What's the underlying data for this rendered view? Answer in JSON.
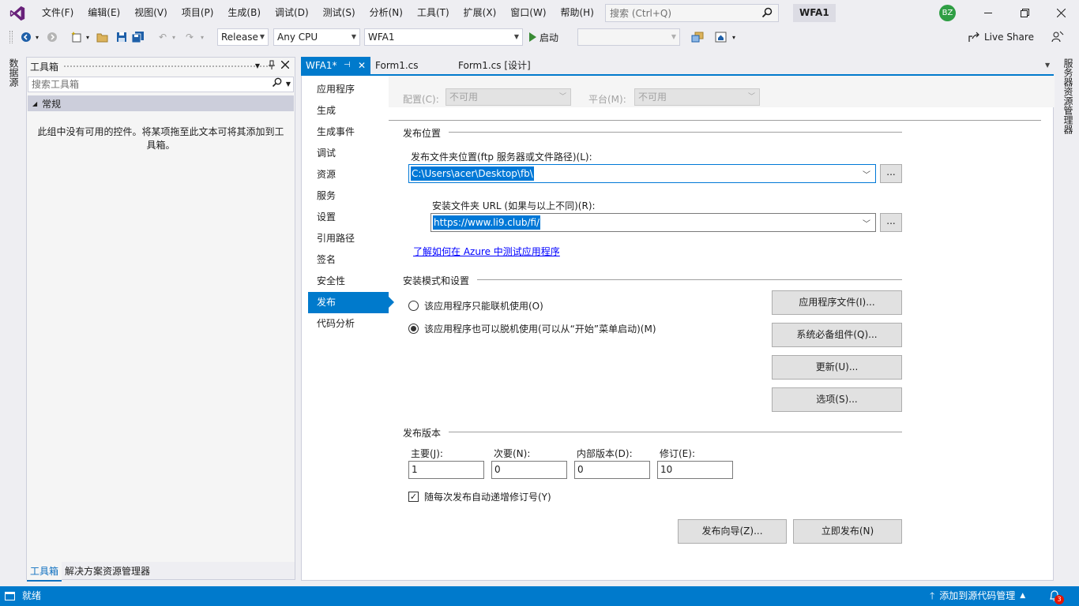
{
  "menu": {
    "items": [
      "文件(F)",
      "编辑(E)",
      "视图(V)",
      "项目(P)",
      "生成(B)",
      "调试(D)",
      "测试(S)",
      "分析(N)",
      "工具(T)",
      "扩展(X)",
      "窗口(W)",
      "帮助(H)"
    ],
    "search_placeholder": "搜索 (Ctrl+Q)",
    "solution_name": "WFA1",
    "user_initials": "BZ"
  },
  "toolbar": {
    "configuration": "Release",
    "platform": "Any CPU",
    "startup_project": "WFA1",
    "start_label": "启动",
    "live_share_label": "Live Share"
  },
  "left_vertical_tab": "数据源",
  "right_vertical_tab": "服务器资源管理器",
  "toolbox": {
    "title": "工具箱",
    "search_placeholder": "搜索工具箱",
    "group_name": "常规",
    "empty_message": "此组中没有可用的控件。将某项拖至此文本可将其添加到工具箱。",
    "bottom_tabs": [
      "工具箱",
      "解决方案资源管理器"
    ]
  },
  "doc_tabs": [
    "WFA1*",
    "Form1.cs",
    "Form1.cs [设计]"
  ],
  "nav_items": [
    "应用程序",
    "生成",
    "生成事件",
    "调试",
    "资源",
    "服务",
    "设置",
    "引用路径",
    "签名",
    "安全性",
    "发布",
    "代码分析"
  ],
  "nav_active_index": 10,
  "config": {
    "config_label": "配置(C):",
    "config_value": "不可用",
    "platform_label": "平台(M):",
    "platform_value": "不可用"
  },
  "publish_location": {
    "section_title": "发布位置",
    "folder_label": "发布文件夹位置(ftp 服务器或文件路径)(L):",
    "folder_value": "C:\\Users\\acer\\Desktop\\fb\\",
    "install_label": "安装文件夹 URL (如果与以上不同)(R):",
    "install_value": "https://www.li9.club/fi/",
    "browse_label": "...",
    "azure_link": "了解如何在 Azure 中测试应用程序"
  },
  "install_mode": {
    "section_title": "安装模式和设置",
    "online_only": "该应用程序只能联机使用(O)",
    "offline_too": "该应用程序也可以脱机使用(可以从“开始”菜单启动)(M)",
    "selected": "offline_too",
    "buttons": [
      "应用程序文件(I)...",
      "系统必备组件(Q)...",
      "更新(U)...",
      "选项(S)..."
    ]
  },
  "publish_version": {
    "section_title": "发布版本",
    "major_label": "主要(J):",
    "major_value": "1",
    "minor_label": "次要(N):",
    "minor_value": "0",
    "build_label": "内部版本(D):",
    "build_value": "0",
    "revision_label": "修订(E):",
    "revision_value": "10",
    "auto_increment_label": "随每次发布自动递增修订号(Y)",
    "auto_increment_checked": true
  },
  "actions": {
    "wizard_label": "发布向导(Z)...",
    "publish_now_label": "立即发布(N)"
  },
  "status": {
    "text": "就绪",
    "source_control": "添加到源代码管理",
    "notifications": "3"
  }
}
